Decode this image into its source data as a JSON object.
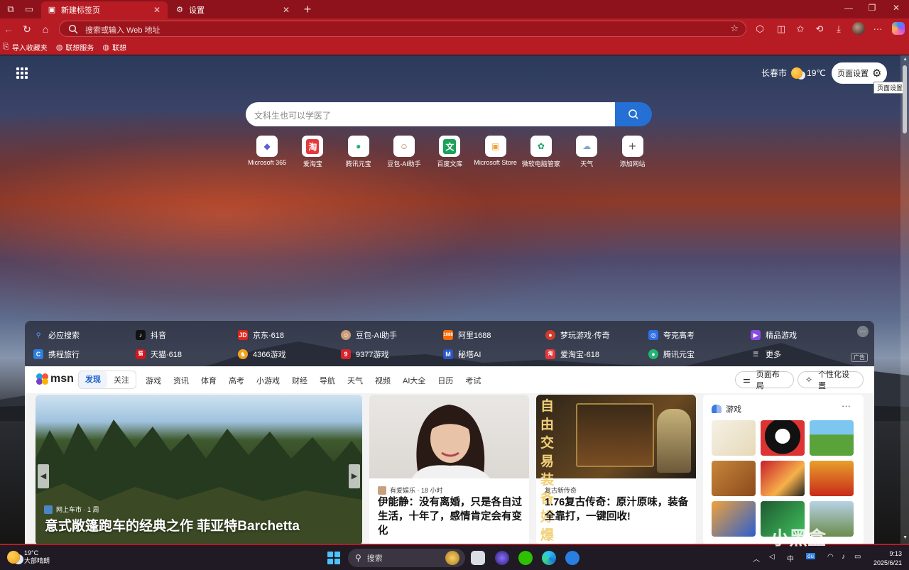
{
  "browser": {
    "tabs": [
      {
        "label": "新建标签页",
        "active": true
      },
      {
        "label": "设置",
        "active": false
      }
    ],
    "address": {
      "placeholder": "搜索或输入 Web 地址"
    },
    "bookmarks": [
      {
        "label": "导入收藏夹",
        "icon": "import-icon"
      },
      {
        "label": "联想服务",
        "icon": "globe-icon"
      },
      {
        "label": "联想",
        "icon": "globe-icon"
      }
    ],
    "colors": {
      "frame": "#8d121b",
      "toolbar": "#b71c24",
      "accent": "#2570d4"
    }
  },
  "newtab": {
    "weather": {
      "city": "长春市",
      "temp": "19℃"
    },
    "page_settings": "页面设置",
    "tooltip": "页面设置",
    "search_placeholder": "文科生也可以学医了",
    "shortcuts": [
      {
        "label": "Microsoft 365",
        "icon": "m365-icon",
        "color": "#5a5fd8",
        "glyph": "◆"
      },
      {
        "label": "爱淘宝",
        "icon": "taobao-icon",
        "color": "#e4393c",
        "glyph": "淘"
      },
      {
        "label": "腾讯元宝",
        "icon": "yuanbao-icon",
        "color": "#22b573",
        "glyph": "●"
      },
      {
        "label": "豆包-AI助手",
        "icon": "doubao-icon",
        "color": "#d9a07a",
        "glyph": "☺"
      },
      {
        "label": "百度文库",
        "icon": "wenku-icon",
        "color": "#1aa25a",
        "glyph": "文"
      },
      {
        "label": "Microsoft Store",
        "icon": "store-icon",
        "color": "#f2a33a",
        "glyph": "▣"
      },
      {
        "label": "微软电脑管家",
        "icon": "pcmanager-icon",
        "color": "#1b9e6b",
        "glyph": "✿"
      },
      {
        "label": "天气",
        "icon": "weather-icon",
        "color": "#f5c04a",
        "glyph": "☁"
      },
      {
        "label": "添加网站",
        "icon": "plus-icon",
        "color": "#555555",
        "glyph": "+"
      }
    ],
    "quicklinks_row1": [
      {
        "label": "必应搜索",
        "color": "#2b6fd6",
        "glyph": "Q"
      },
      {
        "label": "抖音",
        "color": "#111111",
        "glyph": "♪"
      },
      {
        "label": "京东·618",
        "color": "#e1251b",
        "glyph": "JD"
      },
      {
        "label": "豆包-AI助手",
        "color": "#c99b78",
        "glyph": "☺"
      },
      {
        "label": "阿里1688",
        "color": "#ff6a00",
        "glyph": "1688"
      },
      {
        "label": "梦玩游戏·传奇",
        "color": "#d23a2a",
        "glyph": "●"
      },
      {
        "label": "夸克高考",
        "color": "#2f6fe8",
        "glyph": "◎"
      },
      {
        "label": "精品游戏",
        "color": "#8a4be2",
        "glyph": "▶"
      }
    ],
    "quicklinks_row2": [
      {
        "label": "携程旅行",
        "color": "#2b7fe0",
        "glyph": "C"
      },
      {
        "label": "天猫·618",
        "color": "#d6141e",
        "glyph": "猫"
      },
      {
        "label": "4366游戏",
        "color": "#f2a31b",
        "glyph": "♞"
      },
      {
        "label": "9377游戏",
        "color": "#d8232a",
        "glyph": "9"
      },
      {
        "label": "秘塔AI",
        "color": "#2a56c8",
        "glyph": "M"
      },
      {
        "label": "爱淘宝·618",
        "color": "#e4393c",
        "glyph": "淘"
      },
      {
        "label": "腾讯元宝",
        "color": "#22b573",
        "glyph": "●"
      },
      {
        "label": "更多",
        "color": "transparent",
        "glyph": "☰"
      }
    ],
    "ad_label": "广告",
    "feed": {
      "logo": "msn",
      "tabs": [
        "发现",
        "关注"
      ],
      "categories": [
        "游戏",
        "资讯",
        "体育",
        "高考",
        "小游戏",
        "财经",
        "导航",
        "天气",
        "视频",
        "AI大全",
        "日历",
        "考试"
      ],
      "layout_button": "页面布局",
      "personalize_button": "个性化设置",
      "hero": {
        "source": "网上车市 · 1 周",
        "title": "意式敞篷跑车的经典之作 菲亚特Barchetta"
      },
      "card1": {
        "source": "有爱娱乐 · 18 小时",
        "title": "伊能静：没有离婚，只是各自过生活，十年了，感情肯定会有变化"
      },
      "card2": {
        "source": "复古新传奇",
        "title": "1.76复古传奇：原汁原味，装备全靠打，一键回收!",
        "banner": "自由交易 装备好爆"
      },
      "games": {
        "title": "游戏"
      }
    }
  },
  "taskbar": {
    "weather": {
      "temp": "19°C",
      "desc": "大部晴朗"
    },
    "search": "搜索",
    "ime": "中",
    "time": "9:13",
    "date": "2025/6/21"
  },
  "watermark": "小黑盒"
}
